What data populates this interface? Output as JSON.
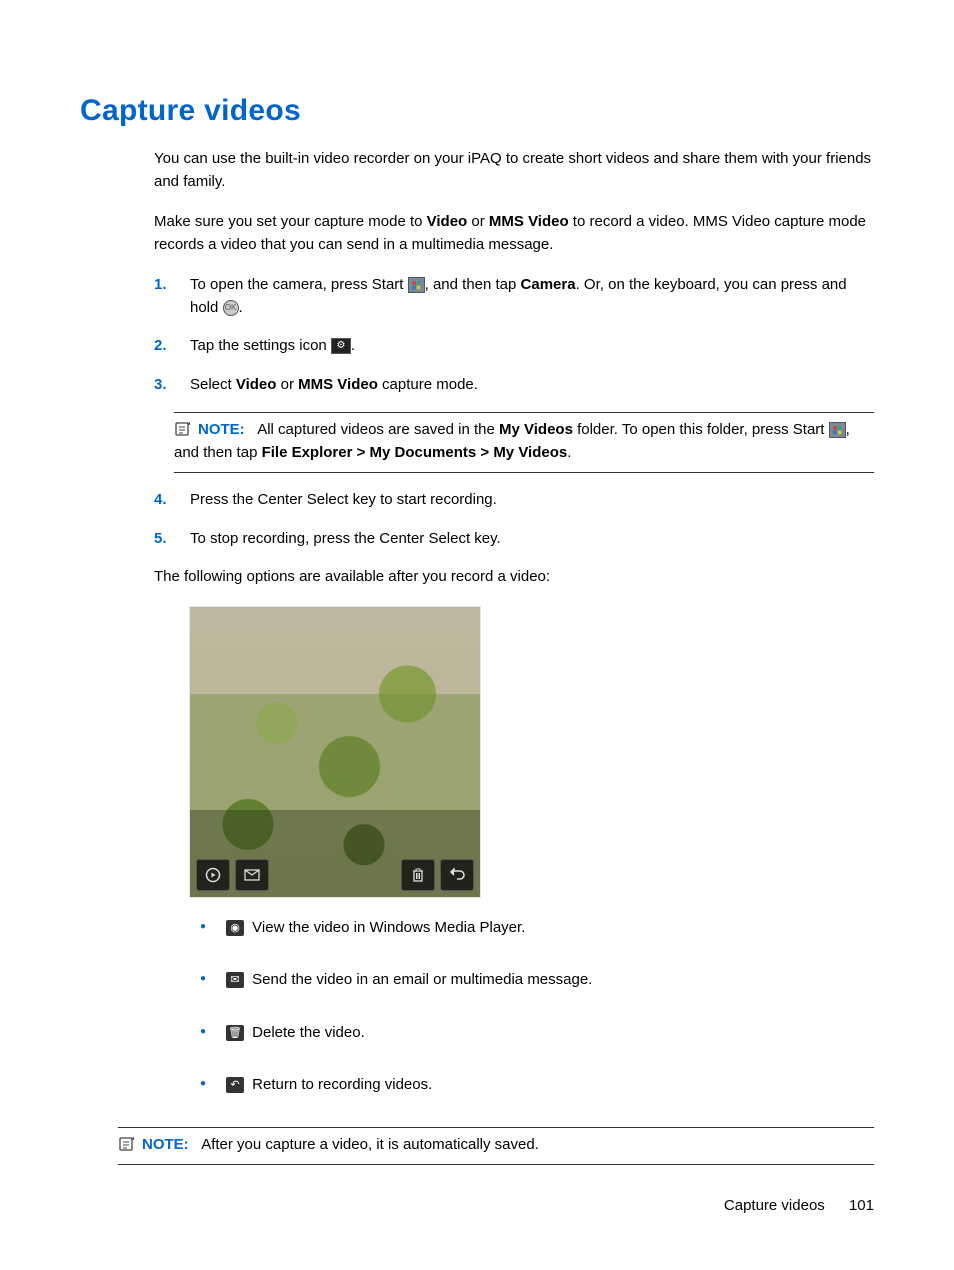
{
  "title": "Capture videos",
  "intro1": "You can use the built-in video recorder on your iPAQ to create short videos and share them with your friends and family.",
  "intro2_pre": "Make sure you set your capture mode to ",
  "intro2_b1": "Video",
  "intro2_mid": " or ",
  "intro2_b2": "MMS Video",
  "intro2_post": " to record a video. MMS Video capture mode records a video that you can send in a multimedia message.",
  "steps": {
    "s1_pre": "To open the camera, press Start ",
    "s1_mid": ", and then tap ",
    "s1_b": "Camera",
    "s1_post": ". Or, on the keyboard, you can press and hold ",
    "s1_end": ".",
    "s2_pre": "Tap the settings icon ",
    "s2_end": ".",
    "s3_pre": "Select ",
    "s3_b1": "Video",
    "s3_mid": " or ",
    "s3_b2": "MMS Video",
    "s3_post": " capture mode.",
    "s4": "Press the Center Select key to start recording.",
    "s5": "To stop recording, press the Center Select key."
  },
  "num": {
    "n1": "1.",
    "n2": "2.",
    "n3": "3.",
    "n4": "4.",
    "n5": "5."
  },
  "note1": {
    "label": "NOTE:",
    "pre": "All captured videos are saved in the ",
    "b1": "My Videos",
    "mid": " folder. To open this folder, press Start ",
    "mid2": ", and then tap ",
    "b2": "File Explorer > My Documents > My Videos",
    "end": "."
  },
  "post_steps": "The following options are available after you record a video:",
  "options": {
    "o1": " View the video in Windows Media Player.",
    "o2": " Send the video in an email or multimedia message.",
    "o3": " Delete the video.",
    "o4": " Return to recording videos."
  },
  "note2": {
    "label": "NOTE:",
    "text": "After you capture a video, it is automatically saved."
  },
  "footer": {
    "section": "Capture videos",
    "page": "101"
  }
}
